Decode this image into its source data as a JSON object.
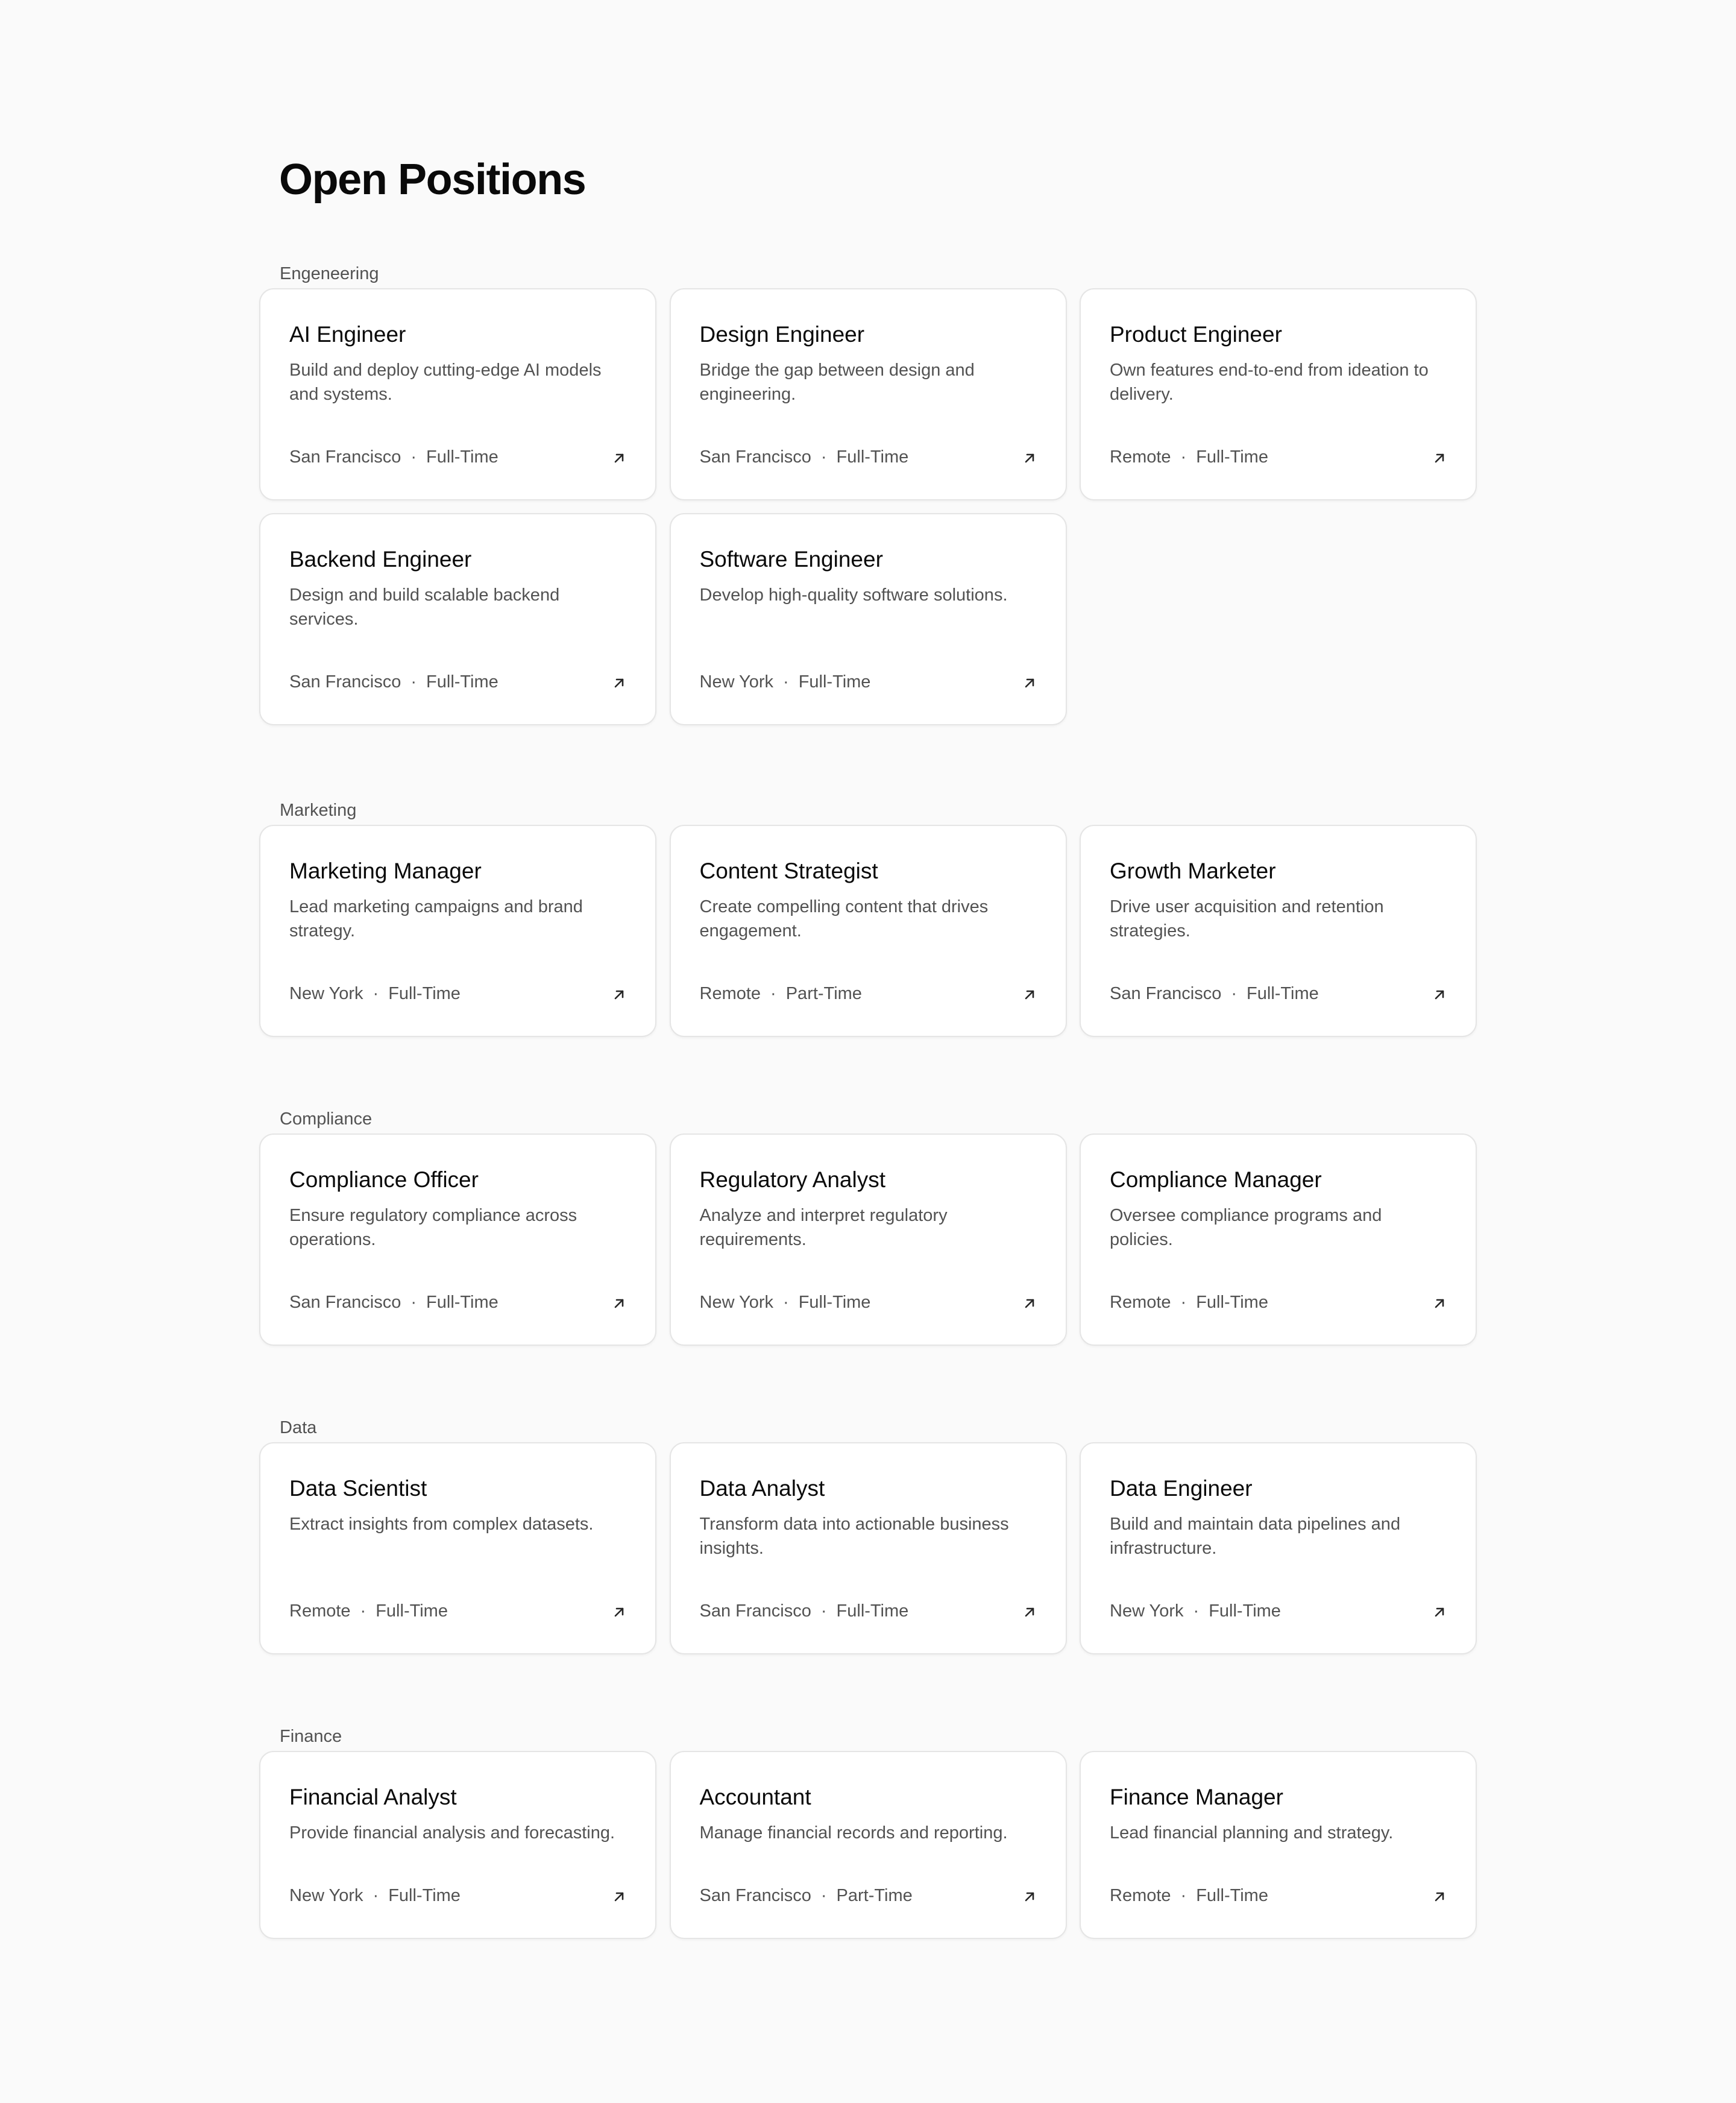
{
  "page": {
    "title": "Open Positions"
  },
  "sections": [
    {
      "label": "Engeneering",
      "jobs": [
        {
          "title": "AI Engineer",
          "description": "Build and deploy cutting-edge AI models and systems.",
          "location": "San Francisco",
          "type": "Full-Time"
        },
        {
          "title": "Design Engineer",
          "description": "Bridge the gap between design and engineering.",
          "location": "San Francisco",
          "type": "Full-Time"
        },
        {
          "title": "Product Engineer",
          "description": "Own features end-to-end from ideation to delivery.",
          "location": "Remote",
          "type": "Full-Time"
        },
        {
          "title": "Backend Engineer",
          "description": "Design and build scalable backend services.",
          "location": "San Francisco",
          "type": "Full-Time"
        },
        {
          "title": "Software Engineer",
          "description": "Develop high-quality software solutions.",
          "location": "New York",
          "type": "Full-Time"
        }
      ]
    },
    {
      "label": "Marketing",
      "jobs": [
        {
          "title": "Marketing Manager",
          "description": "Lead marketing campaigns and brand strategy.",
          "location": "New York",
          "type": "Full-Time"
        },
        {
          "title": "Content Strategist",
          "description": "Create compelling content that drives engagement.",
          "location": "Remote",
          "type": "Part-Time"
        },
        {
          "title": "Growth Marketer",
          "description": "Drive user acquisition and retention strategies.",
          "location": "San Francisco",
          "type": "Full-Time"
        }
      ]
    },
    {
      "label": "Compliance",
      "jobs": [
        {
          "title": "Compliance Officer",
          "description": "Ensure regulatory compliance across operations.",
          "location": "San Francisco",
          "type": "Full-Time"
        },
        {
          "title": "Regulatory Analyst",
          "description": "Analyze and interpret regulatory requirements.",
          "location": "New York",
          "type": "Full-Time"
        },
        {
          "title": "Compliance Manager",
          "description": "Oversee compliance programs and policies.",
          "location": "Remote",
          "type": "Full-Time"
        }
      ]
    },
    {
      "label": "Data",
      "jobs": [
        {
          "title": "Data Scientist",
          "description": "Extract insights from complex datasets.",
          "location": "Remote",
          "type": "Full-Time"
        },
        {
          "title": "Data Analyst",
          "description": "Transform data into actionable business insights.",
          "location": "San Francisco",
          "type": "Full-Time"
        },
        {
          "title": "Data Engineer",
          "description": "Build and maintain data pipelines and infrastructure.",
          "location": "New York",
          "type": "Full-Time"
        }
      ]
    },
    {
      "label": "Finance",
      "jobs": [
        {
          "title": "Financial Analyst",
          "description": "Provide financial analysis and forecasting.",
          "location": "New York",
          "type": "Full-Time"
        },
        {
          "title": "Accountant",
          "description": "Manage financial records and reporting.",
          "location": "San Francisco",
          "type": "Part-Time"
        },
        {
          "title": "Finance Manager",
          "description": "Lead financial planning and strategy.",
          "location": "Remote",
          "type": "Full-Time"
        }
      ]
    }
  ],
  "meta_separator": "·",
  "icons": {
    "card_action": "arrow-up-right-icon"
  },
  "colors": {
    "background": "#fafafa",
    "card": "#ffffff",
    "border": "#e5e5e5",
    "text": "#0a0a0a",
    "muted": "#525252"
  }
}
